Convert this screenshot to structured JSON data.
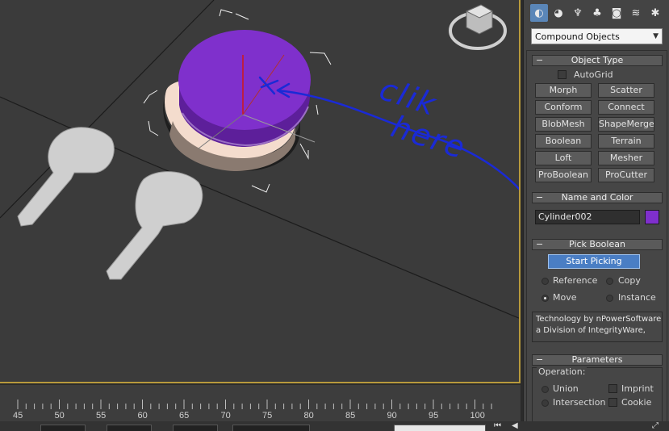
{
  "annotations": {
    "line1": "clik",
    "line2": "here"
  },
  "command_panel": {
    "tabs": [
      {
        "icon": "create-icon",
        "glyph": "◐",
        "active": true
      },
      {
        "icon": "modify-icon",
        "glyph": "◕",
        "active": false
      },
      {
        "icon": "hierarchy-icon",
        "glyph": "♆",
        "active": false
      },
      {
        "icon": "motion-icon",
        "glyph": "♣",
        "active": false
      },
      {
        "icon": "display-icon",
        "glyph": "◙",
        "active": false
      },
      {
        "icon": "utilities-icon",
        "glyph": "≋",
        "active": false
      },
      {
        "icon": "tools-icon",
        "glyph": "✱",
        "active": false
      }
    ],
    "category": "Compound Objects",
    "object_type": {
      "title": "Object Type",
      "autogrid_label": "AutoGrid",
      "buttons": [
        "Morph",
        "Scatter",
        "Conform",
        "Connect",
        "BlobMesh",
        "ShapeMerge",
        "Boolean",
        "Terrain",
        "Loft",
        "Mesher",
        "ProBoolean",
        "ProCutter"
      ]
    },
    "name_and_color": {
      "title": "Name and Color",
      "name_value": "Cylinder002",
      "color": "#7f2fcc"
    },
    "pick_boolean": {
      "title": "Pick Boolean",
      "start_picking": "Start Picking",
      "options": [
        "Reference",
        "Copy",
        "Move",
        "Instance"
      ],
      "selected": "Move",
      "credit_line1": "Technology by nPowerSoftware",
      "credit_line2": "a Division of IntegrityWare,"
    },
    "parameters": {
      "title": "Parameters",
      "operation_label": "Operation:",
      "union": "Union",
      "intersection": "Intersection",
      "imprint": "Imprint",
      "cookie": "Cookie"
    }
  },
  "timeline": {
    "ticks": [
      "45",
      "50",
      "55",
      "60",
      "65",
      "70",
      "75",
      "80",
      "85",
      "90",
      "95",
      "100"
    ]
  },
  "colors": {
    "viewport_bg": "#3b3b3b",
    "active_border": "#b89a3c",
    "cylinder_top": "#7f30cc",
    "base_ring": "#f3dccd",
    "key_shape": "#cfcfcf",
    "annotation_ink": "#1a2ad6"
  }
}
